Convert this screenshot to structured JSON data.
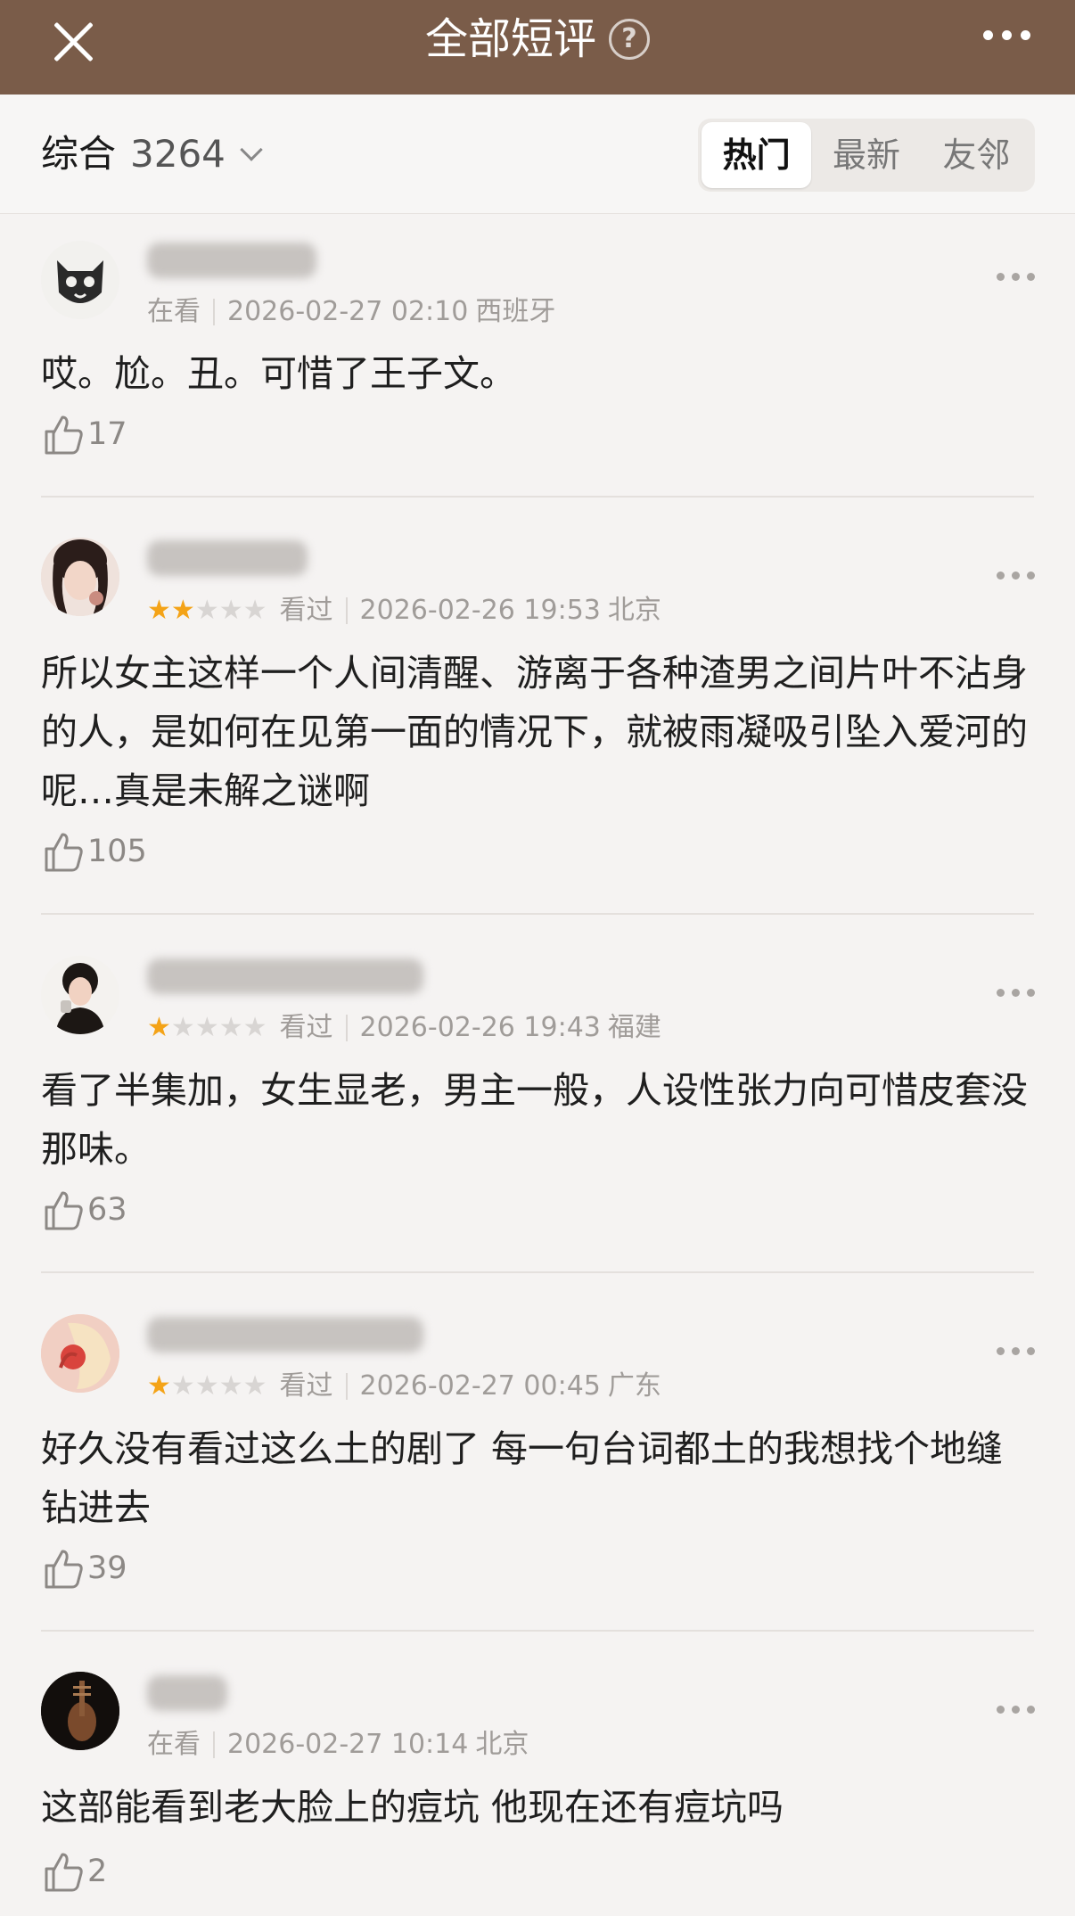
{
  "header": {
    "title": "全部短评",
    "help_icon": "?",
    "close_icon": "close-icon",
    "more_icon": "more-horizontal-icon",
    "bg_color": "#7a5c49"
  },
  "filter": {
    "sort_label": "综合",
    "count": "3264",
    "tabs": [
      "热门",
      "最新",
      "友邻"
    ],
    "active_tab": "热门"
  },
  "comments": [
    {
      "status": "在看",
      "rating": 0,
      "date": "2026-02-27 02:10",
      "location": "西班牙",
      "text": "哎。尬。丑。可惜了王子文。",
      "likes": "17"
    },
    {
      "status": "看过",
      "rating": 2,
      "date": "2026-02-26 19:53",
      "location": "北京",
      "text": "所以女主这样一个人间清醒、游离于各种渣男之间片叶不沾身的人，是如何在见第一面的情况下，就被雨凝吸引坠入爱河的呢…真是未解之谜啊",
      "likes": "105"
    },
    {
      "status": "看过",
      "rating": 1,
      "date": "2026-02-26 19:43",
      "location": "福建",
      "text": "看了半集加，女生显老，男主一般，人设性张力向可惜皮套没那味。",
      "likes": "63"
    },
    {
      "status": "看过",
      "rating": 1,
      "date": "2026-02-27 00:45",
      "location": "广东",
      "text": "好久没有看过这么土的剧了 每一句台词都土的我想找个地缝钻进去",
      "likes": "39"
    },
    {
      "status": "在看",
      "rating": 0,
      "date": "2026-02-27 10:14",
      "location": "北京",
      "text": "这部能看到老大脸上的痘坑 他现在还有痘坑吗",
      "likes": "2"
    }
  ],
  "colors": {
    "star_on": "#f4a317",
    "star_off": "#d8d5d3"
  }
}
